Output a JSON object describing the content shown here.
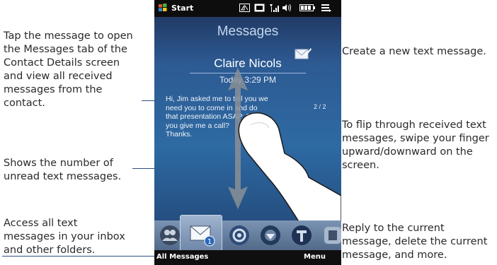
{
  "callouts": {
    "open_message": [
      "Tap the message to open",
      "the Messages tab of the",
      "Contact Details screen",
      "and view all received",
      "messages from the",
      "contact."
    ],
    "unread_count": [
      "Shows the number of",
      "unread text messages."
    ],
    "access_all": [
      "Access all text",
      "messages in your inbox",
      "and other folders."
    ],
    "new_message": [
      "Create a new text message."
    ],
    "flip": [
      "To flip through received text",
      "messages, swipe your finger",
      "upward/downward on the",
      "screen."
    ],
    "reply": [
      "Reply to the current",
      "message, delete the current",
      "message, and more."
    ]
  },
  "phone": {
    "status_bar": {
      "start_label": "Start",
      "icons": [
        "windows-logo-icon",
        "data-icon",
        "3g-icon",
        "signal-icon",
        "speaker-icon",
        "battery-icon",
        "menu-lines-icon"
      ]
    },
    "screen_title": "Messages",
    "sender_name": "Claire Nicols",
    "timestamp": "Today 3:29 PM",
    "message_text": [
      "Hi, Jim asked me to tell you we",
      "need you to come in and do",
      "that presentation ASAP. Can",
      "you give me a call?",
      "Thanks."
    ],
    "counter": "2 / 2",
    "tabs": [
      {
        "icon": "people-icon",
        "selected": false
      },
      {
        "icon": "envelope-icon",
        "selected": true,
        "badge": "1"
      },
      {
        "icon": "email-at-icon",
        "selected": false
      },
      {
        "icon": "internet-icon",
        "selected": false
      },
      {
        "icon": "carrier-t-icon",
        "selected": false
      },
      {
        "icon": "partial-tab-icon",
        "selected": false
      }
    ],
    "softkeys": {
      "left": "All Messages",
      "right": "Menu"
    }
  },
  "colors": {
    "callout_line": "#2f4f7f",
    "screen_bg": "#2e6aa3",
    "text": "#2a2a2a"
  }
}
